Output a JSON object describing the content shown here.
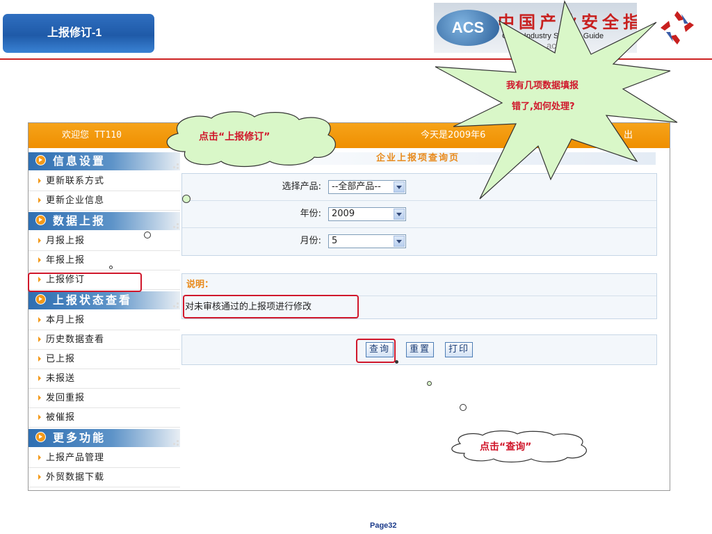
{
  "slide": {
    "title": "上报修订-1",
    "page_label": "Page32"
  },
  "logo": {
    "emblem_text": "ACS",
    "chinese_title": "中国产业安全指南",
    "english_title": "China Industry Security Guide",
    "domain_text": "ac    cn"
  },
  "header": {
    "welcome": "欢迎您 TT110",
    "date_text": "今天是2009年6",
    "logout_text": "出"
  },
  "sidebar": {
    "sections": [
      {
        "title": "信息设置",
        "items": [
          "更新联系方式",
          "更新企业信息"
        ]
      },
      {
        "title": "数据上报",
        "items": [
          "月报上报",
          "年报上报",
          "上报修订"
        ]
      },
      {
        "title": "上报状态查看",
        "items": [
          "本月上报",
          "历史数据查看",
          "已上报",
          "未报送",
          "发回重报",
          "被催报"
        ]
      },
      {
        "title": "更多功能",
        "items": [
          "上报产品管理",
          "外贸数据下载"
        ]
      }
    ]
  },
  "main": {
    "title": "企业上报项查询页",
    "form": {
      "product_label": "选择产品:",
      "product_value": "--全部产品--",
      "year_label": "年份:",
      "year_value": "2009",
      "month_label": "月份:",
      "month_value": "5"
    },
    "note_title": "说明：",
    "note_text": "对未审核通过的上报项进行修改",
    "buttons": {
      "query": "查询",
      "reset": "重置",
      "print": "打印"
    }
  },
  "annotations": {
    "cloud_left": "点击“上报修订”",
    "cloud_bottom": "点击“查询”",
    "starburst_line1": "我有几项数据填报",
    "starburst_line2": "错了,如何处理?",
    "highlight_color": "#d0172b"
  },
  "colors": {
    "header_orange": "#ef8f00",
    "section_blue": "#2f6fb2",
    "accent_orange": "#e8891a",
    "slide_rule_red": "#cc2222"
  }
}
